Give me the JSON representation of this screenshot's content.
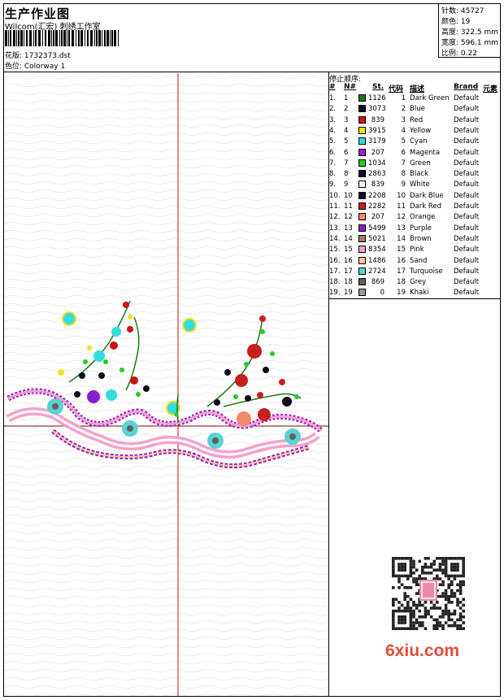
{
  "header": {
    "title": "生产作业图",
    "company": "Wilcom(汇宏) 刺绣工作室",
    "design_label": "花版: 1732373.dst",
    "colorway_label": "色位: Colorway 1"
  },
  "info": {
    "stitches": "针数: 45727",
    "colors": "颜色: 19",
    "height": "高度: 322.5 mm",
    "width": "宽度: 596.1 mm",
    "scale": "比例: 0.22"
  },
  "stop_sequence": {
    "title": "停止顺序:",
    "headers": {
      "idx": "#",
      "no": "N#",
      "st": "St.",
      "code": "代码",
      "desc": "描述",
      "brand": "Brand",
      "elem": "元素"
    },
    "rows": [
      {
        "idx": "1.",
        "no": "1",
        "st": "1126",
        "code": "1",
        "desc": "Dark Green",
        "brand": "Default",
        "color": "#1a7a1a"
      },
      {
        "idx": "2.",
        "no": "2",
        "st": "3073",
        "code": "2",
        "desc": "Blue",
        "brand": "Default",
        "color": "#0a0a2a"
      },
      {
        "idx": "3.",
        "no": "3",
        "st": "839",
        "code": "3",
        "desc": "Red",
        "brand": "Default",
        "color": "#cc1111"
      },
      {
        "idx": "4.",
        "no": "4",
        "st": "3915",
        "code": "4",
        "desc": "Yellow",
        "brand": "Default",
        "color": "#f2e21a"
      },
      {
        "idx": "5.",
        "no": "5",
        "st": "3179",
        "code": "5",
        "desc": "Cyan",
        "brand": "Default",
        "color": "#33dddd"
      },
      {
        "idx": "6.",
        "no": "6",
        "st": "207",
        "code": "6",
        "desc": "Magenta",
        "brand": "Default",
        "color": "#9a22c8"
      },
      {
        "idx": "7.",
        "no": "7",
        "st": "1034",
        "code": "7",
        "desc": "Green",
        "brand": "Default",
        "color": "#22cc22"
      },
      {
        "idx": "8.",
        "no": "8",
        "st": "2863",
        "code": "8",
        "desc": "Black",
        "brand": "Default",
        "color": "#0a0a1a"
      },
      {
        "idx": "9.",
        "no": "9",
        "st": "839",
        "code": "9",
        "desc": "White",
        "brand": "Default",
        "color": "#f4f4f4"
      },
      {
        "idx": "10.",
        "no": "10",
        "st": "2208",
        "code": "10",
        "desc": "Dark Blue",
        "brand": "Default",
        "color": "#0a0a2a"
      },
      {
        "idx": "11.",
        "no": "11",
        "st": "2282",
        "code": "11",
        "desc": "Dark Red",
        "brand": "Default",
        "color": "#c81e1e"
      },
      {
        "idx": "12.",
        "no": "12",
        "st": "207",
        "code": "12",
        "desc": "Orange",
        "brand": "Default",
        "color": "#f08a6a"
      },
      {
        "idx": "13.",
        "no": "13",
        "st": "5499",
        "code": "13",
        "desc": "Purple",
        "brand": "Default",
        "color": "#8a1ec8"
      },
      {
        "idx": "14.",
        "no": "14",
        "st": "5021",
        "code": "14",
        "desc": "Brown",
        "brand": "Default",
        "color": "#a8785a"
      },
      {
        "idx": "15.",
        "no": "15",
        "st": "8354",
        "code": "15",
        "desc": "Pink",
        "brand": "Default",
        "color": "#f4a0cc"
      },
      {
        "idx": "16.",
        "no": "16",
        "st": "1486",
        "code": "16",
        "desc": "Sand",
        "brand": "Default",
        "color": "#f4c896"
      },
      {
        "idx": "17.",
        "no": "17",
        "st": "2724",
        "code": "17",
        "desc": "Turquoise",
        "brand": "Default",
        "color": "#5ad2d2"
      },
      {
        "idx": "18.",
        "no": "18",
        "st": "869",
        "code": "18",
        "desc": "Grey",
        "brand": "Default",
        "color": "#606060"
      },
      {
        "idx": "19.",
        "no": "19",
        "st": "0",
        "code": "19",
        "desc": "Khaki",
        "brand": "Default",
        "color": "#9a9a9a"
      }
    ]
  },
  "watermark": "6xiu.com",
  "icons": {
    "barcode": "barcode-icon",
    "qr": "qr-code-icon",
    "logo": "6xiu-logo"
  }
}
